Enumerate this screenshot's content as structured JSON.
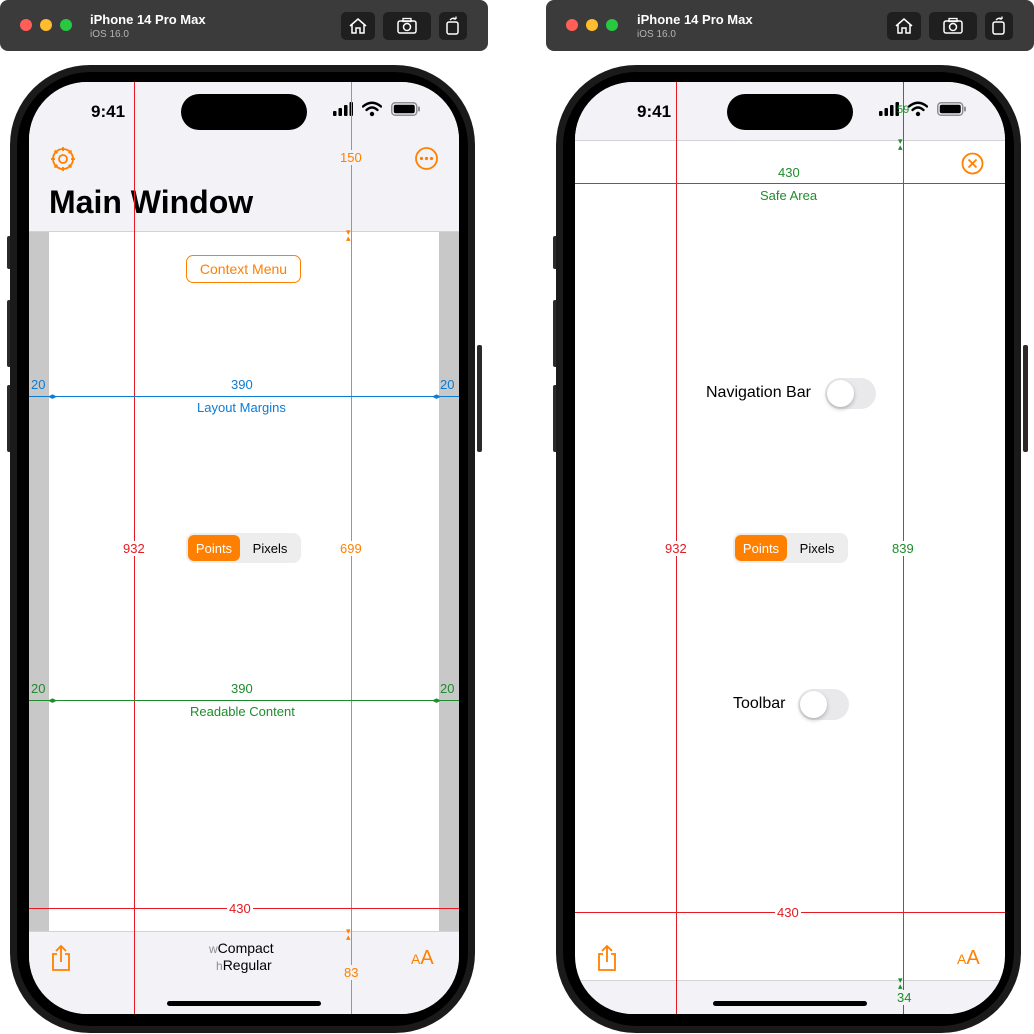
{
  "colors": {
    "accent": "#ff8000",
    "safe_area": "#1e8c2d",
    "layout_margins": "#0a7cd6",
    "screen_size": "#e51a22",
    "margin_gutter": "#c8c8c8",
    "bar_bg": "#f2f2f7"
  },
  "left_window": {
    "title": "iPhone 14 Pro Max",
    "subtitle": "iOS 16.0"
  },
  "right_window": {
    "title": "iPhone 14 Pro Max",
    "subtitle": "iOS 16.0"
  },
  "left_screen": {
    "time": "9:41",
    "nav_title": "Main Window",
    "context_menu_label": "Context Menu",
    "segment": {
      "selected": "Points",
      "other": "Pixels"
    },
    "size_class_w_prefix": "w",
    "size_class_w": "Compact",
    "size_class_h_prefix": "h",
    "size_class_h": "Regular",
    "measurements": {
      "top_bar_height": "150",
      "content_height": "699",
      "bottom_bar_height": "83",
      "screen_height": "932",
      "screen_width": "430",
      "margin_left": "20",
      "margin_right": "20",
      "margin_width": "390",
      "margin_label": "Layout Margins",
      "readable_left": "20",
      "readable_right": "20",
      "readable_width": "390",
      "readable_label": "Readable Content"
    },
    "icons": {
      "settings": "gear-icon",
      "more": "ellipsis-circle-icon",
      "share": "share-icon",
      "text_size": "text-size-icon"
    }
  },
  "right_screen": {
    "time": "9:41",
    "navigation_bar_label": "Navigation Bar",
    "toolbar_label": "Toolbar",
    "segment": {
      "selected": "Points",
      "other": "Pixels"
    },
    "measurements": {
      "top_inset": "59",
      "safe_width": "430",
      "safe_area_label": "Safe Area",
      "safe_height": "839",
      "screen_height": "932",
      "screen_width": "430",
      "bottom_inset": "34"
    },
    "icons": {
      "close": "close-circle-icon",
      "share": "share-icon",
      "text_size": "text-size-icon"
    }
  }
}
